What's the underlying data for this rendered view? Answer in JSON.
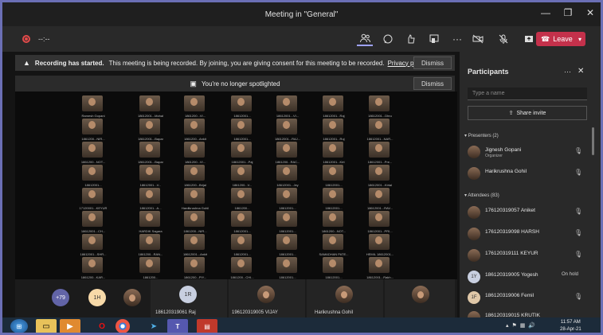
{
  "window": {
    "title": "Meeting in \"General\"",
    "minimize": "—",
    "restore": "❐",
    "close": "✕"
  },
  "toolbar": {
    "timer": "--:--",
    "leave_label": "Leave",
    "icons": [
      "participants-icon",
      "chat-icon",
      "reactions-icon",
      "rooms-icon",
      "more-actions-icon"
    ],
    "right_icons": [
      "camera-off-icon",
      "mic-off-icon",
      "share-icon"
    ]
  },
  "banners": {
    "recording_bold": "Recording has started.",
    "recording_text": "This meeting is being recorded. By joining, you are giving consent for this meeting to be recorded.",
    "recording_link": "Privacy policy",
    "spotlight_text": "You're no longer spotlighted",
    "dismiss": "Dismiss"
  },
  "grid_captions": [
    [
      "Ramesh Gopani",
      "18612001...Mohal",
      "1861200...VI...",
      "18612001...",
      "18612001...VI...",
      "18612001...Raj",
      "18612001...Dhru"
    ],
    [
      "1861200...NIR...",
      "18612001...Bapar",
      "1861200...Ankit",
      "18612001...",
      "18612001...RAJ...",
      "18612001...Ruj",
      "18612001...NAR..."
    ],
    [
      "1861200...NOT...",
      "18612001...Bapar",
      "1861200...VI...",
      "18612001...Paj",
      "1861200...RAC...",
      "18612001...Kirt",
      "18612001...Pre..."
    ],
    [
      "18612001...",
      "18612001...V...",
      "1861200...Brijal",
      "1861200...V...",
      "18612001...Jey",
      "18612001...",
      "18612001...Kirtal"
    ],
    [
      "17120001...KEYUR",
      "18612001...A...",
      "Hardikrushna Gohil",
      "1861200...",
      "18612001...",
      "18612001...",
      "18612001...RAV..."
    ],
    [
      "18612001...CH...",
      "HARDIK Sagara",
      "1861200...NIR...",
      "18612001...",
      "18612001...",
      "1861200...NOT...",
      "18612001...PRI..."
    ],
    [
      "18612001...SHR...",
      "1861200...RAN...",
      "18612001...Ankit",
      "18612001...",
      "18612001...",
      "SAMADHAN PATE...",
      "HEMIL 18612001..."
    ],
    [
      "1861200...KAR...",
      "1861200...",
      "1861200...PIY...",
      "1861200...CHI...",
      "18612001...",
      "18612001...",
      "18612001...Rakh..."
    ]
  ],
  "strip": {
    "more_count": "+79",
    "ih_initials": "1H",
    "ir_initials": "1R",
    "tiles": [
      {
        "name": "186120319061 Raj"
      },
      {
        "name": "196120319005 VIJAY"
      },
      {
        "name": "Harikrushna Gohil"
      }
    ]
  },
  "panel": {
    "title": "Participants",
    "more": "···",
    "close": "✕",
    "search_placeholder": "Type a name",
    "share_invite": "Share invite",
    "presenters_label": "Presenters (2)",
    "attendees_label": "Attendees (83)",
    "presenters": [
      {
        "name": "Jignesh Gopani",
        "role": "Organizer"
      },
      {
        "name": "Harikrushna Gohil",
        "role": ""
      }
    ],
    "attendees": [
      {
        "name": "176120319057 Aniket",
        "status": "",
        "initials": ""
      },
      {
        "name": "176120319098 HARSH",
        "status": "",
        "initials": ""
      },
      {
        "name": "176120319111 KEYUR",
        "status": "",
        "initials": ""
      },
      {
        "name": "186120319005 Yogesh",
        "status": "On hold",
        "initials": "1Y"
      },
      {
        "name": "186120319006 Femil",
        "status": "",
        "initials": "1F"
      },
      {
        "name": "186120319015 KRUTIK",
        "status": "",
        "initials": ""
      }
    ]
  },
  "taskbar": {
    "time": "11:57 AM",
    "date": "28-Apr-21",
    "teams_label": "T",
    "start_label": "⊞"
  },
  "colors": {
    "accent": "#6264a7",
    "leave": "#c4314b",
    "frame": "#6b6fb5"
  }
}
